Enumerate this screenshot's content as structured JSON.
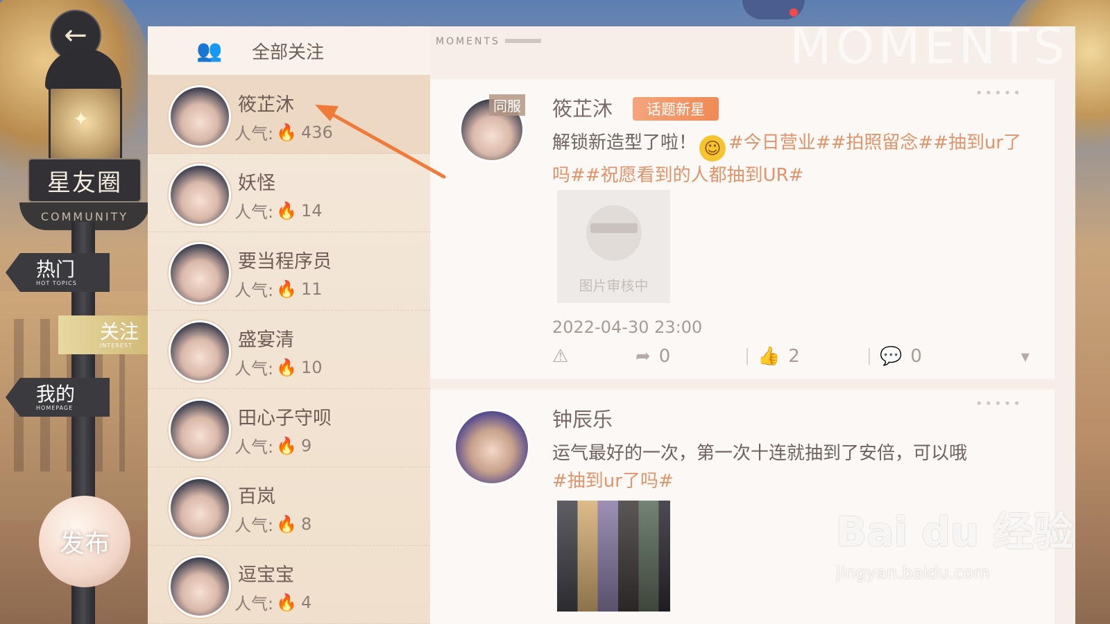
{
  "left_nav": {
    "community_title": "星友圈",
    "community_ribbon": "COMMUNITY",
    "items": [
      {
        "label": "热门",
        "sub": "HOT TOPICS"
      },
      {
        "label": "关注",
        "sub": "INTEREST"
      },
      {
        "label": "我的",
        "sub": "HOMEPAGE"
      }
    ],
    "publish_label": "发布"
  },
  "follow_list": {
    "header": "全部关注",
    "popularity_label": "人气:",
    "friends": [
      {
        "name": "筱芷沐",
        "popularity": "436"
      },
      {
        "name": "妖怪",
        "popularity": "14"
      },
      {
        "name": "要当程序员",
        "popularity": "11"
      },
      {
        "name": "盛宴清",
        "popularity": "10"
      },
      {
        "name": "田心子守呗",
        "popularity": "9"
      },
      {
        "name": "百岚",
        "popularity": "8"
      },
      {
        "name": "逗宝宝",
        "popularity": "4"
      }
    ]
  },
  "moments": {
    "label": "MOMENTS",
    "watermark": "MOMENTS",
    "posts": [
      {
        "name": "筱芷沐",
        "server_tag": "同服",
        "badge": "话题新星",
        "text": "解锁新造型了啦！",
        "hashtags": "#今日营业##拍照留念##抽到ur了吗##祝愿看到的人都抽到UR#",
        "image_caption": "图片审核中",
        "time": "2022-04-30  23:00",
        "shares": "0",
        "likes": "2",
        "comments": "0"
      },
      {
        "name": "钟辰乐",
        "text": "运气最好的一次，第一次十连就抽到了安倍，可以哦",
        "hashtags": "#抽到ur了吗#"
      }
    ]
  },
  "watermark": {
    "brand": "Bai du 经验",
    "url": "jingyan.baidu.com"
  },
  "colors": {
    "accent": "#f08a55",
    "hashtag": "#e0946a",
    "annotation_arrow": "#f07a3a"
  }
}
